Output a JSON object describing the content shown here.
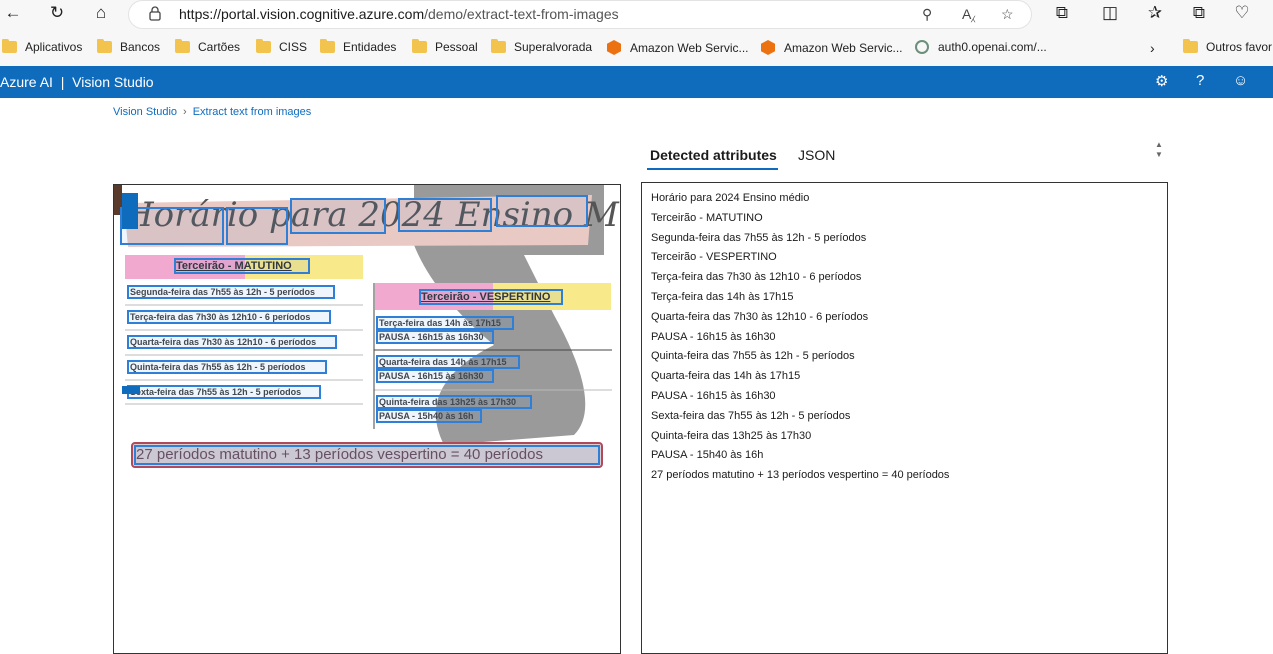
{
  "browser": {
    "url_prefix": "https://portal.vision.cognitive.azure.com",
    "url_path": "/demo/extract-text-from-images",
    "bookmarks": [
      "Aplicativos",
      "Bancos",
      "Cartões",
      "CISS",
      "Entidades",
      "Pessoal",
      "Superalvorada",
      "Amazon Web Servic...",
      "Amazon Web Servic...",
      "auth0.openai.com/..."
    ],
    "other_bookmarks": "Outros favor"
  },
  "app": {
    "title": "Azure AI",
    "subtitle": "Vision Studio"
  },
  "breadcrumb": {
    "root": "Vision Studio",
    "current": "Extract text from images"
  },
  "tabs": {
    "detected": "Detected attributes",
    "json": "JSON"
  },
  "poster": {
    "title": "Horário para 2024 Ensino Médio",
    "matutino_header": "Terceirão - MATUTINO",
    "matutino_rows": [
      "Segunda-feira das 7h55 às 12h - 5 períodos",
      "Terça-feira das 7h30 às 12h10 - 6 períodos",
      "Quarta-feira das 7h30 às 12h10 - 6 períodos",
      "Quinta-feira das 7h55 às 12h - 5 períodos",
      "Sexta-feira das 7h55 às 12h - 5 períodos"
    ],
    "vespertino_header": "Terceirão - VESPERTINO",
    "vespertino_rows": [
      [
        "Terça-feira das 14h às 17h15",
        "PAUSA - 16h15 às 16h30"
      ],
      [
        "Quarta-feira das 14h às 17h15",
        "PAUSA - 16h15 às 16h30"
      ],
      [
        "Quinta-feira das 13h25 às 17h30",
        "PAUSA - 15h40 às 16h"
      ]
    ],
    "summary": "27 períodos matutino + 13 períodos vespertino = 40 períodos"
  },
  "detected_lines": [
    "Horário para 2024 Ensino médio",
    "Terceirão - MATUTINO",
    "Segunda-feira das 7h55 às 12h - 5 períodos",
    "Terceirão - VESPERTINO",
    "Terça-feira das 7h30 às 12h10 - 6 períodos",
    "Terça-feira das 14h às 17h15",
    "Quarta-feira das 7h30 às 12h10 - 6 períodos",
    "PAUSA - 16h15 às 16h30",
    "Quinta-feira das 7h55 às 12h - 5 períodos",
    "Quarta-feira das 14h às 17h15",
    "PAUSA - 16h15 às 16h30",
    "Sexta-feira das 7h55 às 12h - 5 períodos",
    "Quinta-feira das 13h25 às 17h30",
    "PAUSA - 15h40 às 16h",
    "27 períodos matutino + 13 períodos vespertino = 40 períodos"
  ],
  "colors": {
    "azure_blue": "#0f6cbd",
    "ocr_box": "#2f7fd6",
    "summary_box": "#b04a5a"
  }
}
